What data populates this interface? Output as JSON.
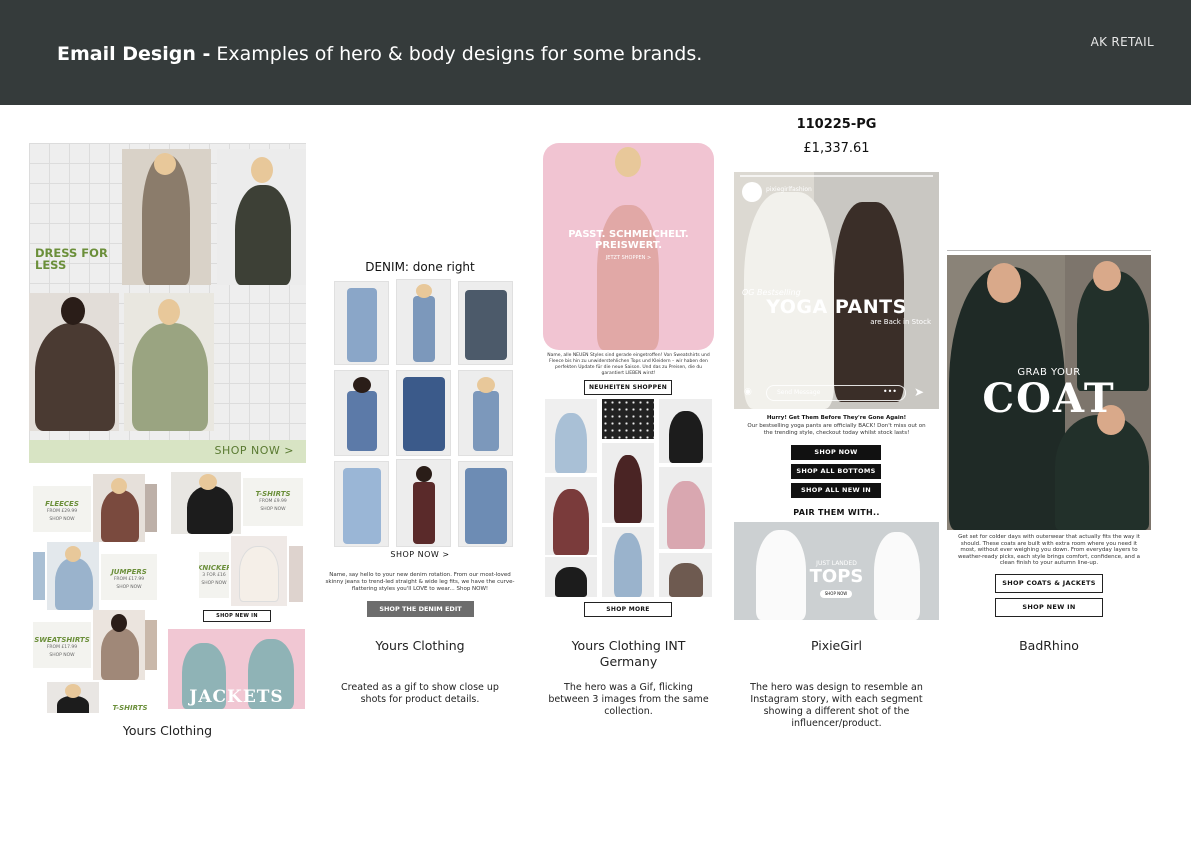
{
  "header": {
    "title_bold": "Email Design -",
    "title_rest": "Examples of hero & body designs for some brands.",
    "brand": "AK RETAIL"
  },
  "colors": {
    "header_bg": "#353b3b",
    "accent_green": "#6b8f3a",
    "pink": "#f1c7d3"
  },
  "panel1": {
    "hero_headline": "DRESS FOR LESS",
    "shop_now": "SHOP NOW >",
    "tiles": {
      "fleeces": "FLEECES",
      "fleeces_price": "FROM £29.99",
      "tshirts_1": "T-SHIRTS",
      "tshirts_1_price": "FROM £9.99",
      "jumpers": "JUMPERS",
      "jumpers_price": "FROM £17.99",
      "knickers": "KNICKERS",
      "knickers_price": "3 FOR £16",
      "sweatshirts": "SWEATSHIRTS",
      "sweatshirts_price": "FROM £17.99",
      "tshirts_2": "T-SHIRTS",
      "jackets": "JACKETS",
      "shop_now_small": "SHOP NOW",
      "shop_new_in": "SHOP NEW IN"
    },
    "caption": "Yours Clothing"
  },
  "panel2": {
    "headline": "DENIM: done right",
    "shop_now": "SHOP NOW >",
    "body": "Name, say hello to your new denim rotation. From our most-loved skinny jeans to trend-led straight & wide leg fits, we have the curve-flattering styles you'll LOVE to wear... Shop NOW!",
    "button": "SHOP THE DENIM EDIT",
    "caption": "Yours Clothing",
    "desc": "Created as a gif to show close up shots for product details."
  },
  "panel3": {
    "hero_headline_1": "PASST. SCHMEICHELT.",
    "hero_headline_2": "PREISWERT.",
    "hero_sub": "JETZT SHOPPEN >",
    "body": "Name, alle NEUEN Styles sind gerade eingetroffen! Von Sweatshirts und Fleece bis hin zu unwiderstehlichen Tops und Kleidern – wir haben den perfekten Update für die neue Saison. Und das zu Preisen, die du garantiert LIEBEN wirst!",
    "button_1": "NEUHEITEN SHOPPEN",
    "button_2": "SHOP MORE",
    "caption": "Yours Clothing INT Germany",
    "desc": "The hero was a Gif, flicking between 3 images from the same collection."
  },
  "panel4": {
    "code": "110225-PG",
    "price": "£1,337.61",
    "story_handle": "pixiegirlfashion",
    "hero_small": "OG Bestselling",
    "hero_headline": "YOGA PANTS",
    "hero_sub": "are Back in Stock",
    "message_placeholder": "Send Message",
    "hurry": "Hurry! Get Them Before They're Gone Again!",
    "body": "Our bestselling yoga pants are officially BACK! Don't miss out on the trending style, checkout today whilst stock lasts!",
    "btn_shop_now": "SHOP NOW",
    "btn_bottoms": "SHOP ALL BOTTOMS",
    "btn_new_in": "SHOP ALL NEW IN",
    "pair": "PAIR THEM WITH..",
    "tops_small": "JUST LANDED",
    "tops": "TOPS",
    "tops_btn": "SHOP NOW",
    "caption": "PixieGirl",
    "desc": "The hero was design to resemble an Instagram story, with each segment showing a different shot of the influencer/product."
  },
  "panel5": {
    "hero_small": "GRAB YOUR",
    "hero_big": "COAT",
    "body": "Get set for colder days with outerwear that actually fits the way it should. These coats are built with extra room where you need it most, without ever weighing you down. From everyday layers to weather-ready picks, each style brings comfort, confidence, and a clean finish to your autumn line-up.",
    "btn_coats": "SHOP COATS & JACKETS",
    "btn_new": "SHOP NEW IN",
    "caption": "BadRhino"
  }
}
